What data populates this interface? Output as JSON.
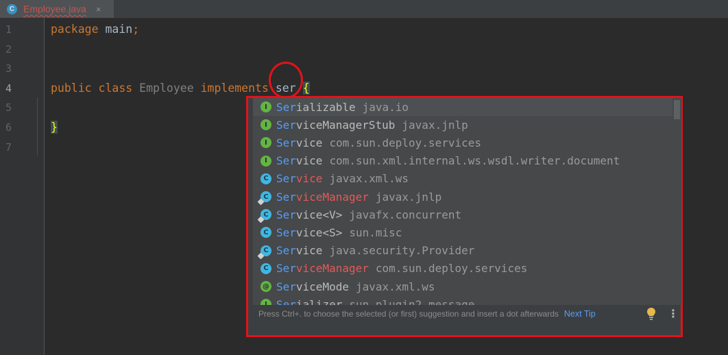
{
  "tab": {
    "icon": "class-icon",
    "icon_letter": "C",
    "label": "Employee.java",
    "close": "×"
  },
  "gutter": {
    "line_numbers": [
      "1",
      "2",
      "3",
      "4",
      "5",
      "6",
      "7"
    ],
    "active_line": "4"
  },
  "code": {
    "line1": {
      "keyword": "package",
      "text": " main",
      "semi": ";"
    },
    "line4": {
      "kw_public": "public",
      "kw_class": "class",
      "class_name": "Employee",
      "kw_implements": "implements",
      "typed": "ser",
      "brace_open": "{"
    },
    "line6": {
      "brace_close": "}"
    }
  },
  "popup": {
    "items": [
      {
        "kind": "interface",
        "icon_letter": "I",
        "match": "Ser",
        "rest": "ializable",
        "rest_red": false,
        "package": "java.io",
        "selected": true
      },
      {
        "kind": "interface",
        "icon_letter": "I",
        "match": "Ser",
        "rest": "viceManagerStub",
        "rest_red": false,
        "package": "javax.jnlp",
        "selected": false
      },
      {
        "kind": "interface",
        "icon_letter": "I",
        "match": "Ser",
        "rest": "vice",
        "rest_red": false,
        "package": "com.sun.deploy.services",
        "selected": false
      },
      {
        "kind": "interface",
        "icon_letter": "I",
        "match": "Ser",
        "rest": "vice",
        "rest_red": false,
        "package": "com.sun.xml.internal.ws.wsdl.writer.document",
        "selected": false
      },
      {
        "kind": "class",
        "icon_letter": "C",
        "match": "Ser",
        "rest": "vice",
        "rest_red": true,
        "package": "javax.xml.ws",
        "selected": false
      },
      {
        "kind": "class",
        "icon_letter": "C",
        "match": "Ser",
        "rest": "viceManager",
        "rest_red": true,
        "package": "javax.jnlp",
        "selected": false
      },
      {
        "kind": "class",
        "icon_letter": "C",
        "match": "Ser",
        "rest": "vice<V>",
        "rest_red": false,
        "package": "javafx.concurrent",
        "selected": false
      },
      {
        "kind": "class",
        "icon_letter": "C",
        "match": "Ser",
        "rest": "vice<S>",
        "rest_red": false,
        "package": "sun.misc",
        "selected": false
      },
      {
        "kind": "class",
        "icon_letter": "C",
        "match": "Ser",
        "rest": "vice",
        "rest_red": false,
        "package": "java.security.Provider",
        "selected": false
      },
      {
        "kind": "class",
        "icon_letter": "C",
        "match": "Ser",
        "rest": "viceManager",
        "rest_red": true,
        "package": "com.sun.deploy.services",
        "selected": false
      },
      {
        "kind": "annotation",
        "icon_letter": "@",
        "match": "Ser",
        "rest": "viceMode",
        "rest_red": false,
        "package": "javax.xml.ws",
        "selected": false
      },
      {
        "kind": "interface",
        "icon_letter": "I",
        "match": "Ser",
        "rest": "ializer",
        "rest_red": false,
        "package": "sun.plugin2.message",
        "selected": false
      }
    ],
    "footer_text": "Press Ctrl+. to choose the selected (or first) suggestion and insert a dot afterwards",
    "next_tip": "Next Tip",
    "more_icon": "⋮"
  },
  "colors": {
    "annotation_red": "#e3121a",
    "match_blue": "#589df6",
    "keyword_orange": "#cc7832"
  }
}
